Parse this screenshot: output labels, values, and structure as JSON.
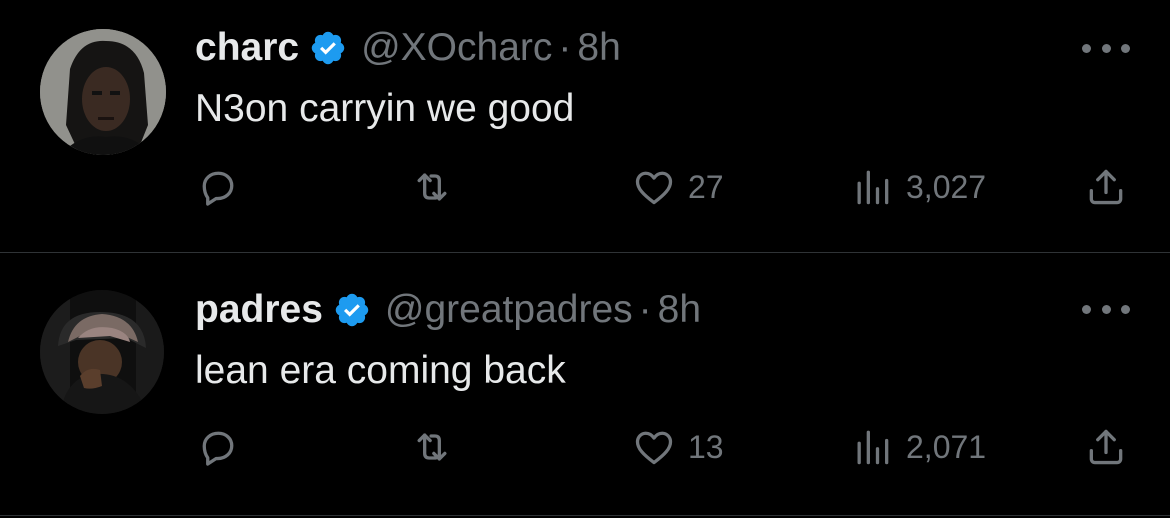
{
  "colors": {
    "background": "#000000",
    "text_primary": "#e7e9ea",
    "text_secondary": "#71767b",
    "verified_badge": "#1d9bf0",
    "divider": "#2f3336"
  },
  "tweets": [
    {
      "display_name": "charc",
      "handle": "@XOcharc",
      "separator": "·",
      "time": "8h",
      "text": "N3on carryin we good",
      "verified": true,
      "replies": "",
      "retweets": "",
      "likes": "27",
      "views": "3,027"
    },
    {
      "display_name": "padres",
      "handle": "@greatpadres",
      "separator": "·",
      "time": "8h",
      "text": "lean era coming back",
      "verified": true,
      "replies": "",
      "retweets": "",
      "likes": "13",
      "views": "2,071"
    }
  ],
  "icons": {
    "avatar": "avatar-photo",
    "verified": "verified-badge-icon",
    "more": "more-options-icon",
    "reply": "reply-icon",
    "retweet": "retweet-icon",
    "like": "heart-icon",
    "views": "views-chart-icon",
    "share": "share-icon"
  }
}
